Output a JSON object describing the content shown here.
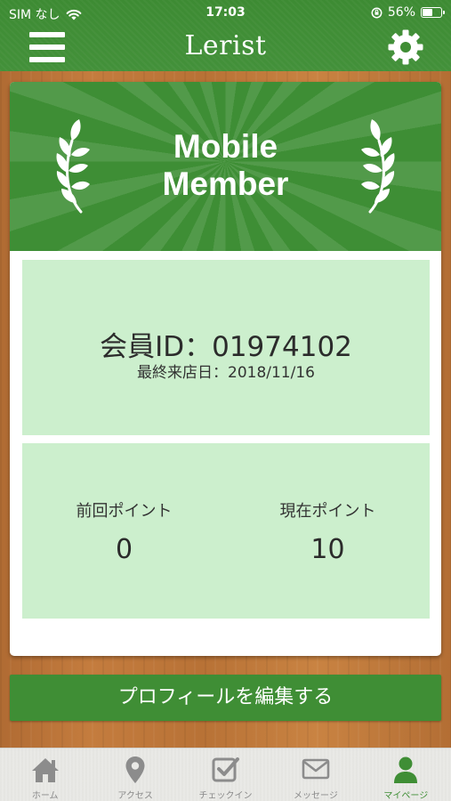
{
  "status": {
    "carrier": "SIM なし",
    "time": "17:03",
    "battery_text": "56%",
    "battery_level": 0.56
  },
  "header": {
    "title": "Lerist",
    "menu_icon": "hamburger-menu-icon",
    "settings_icon": "gear-icon"
  },
  "card": {
    "banner_title_line1": "Mobile",
    "banner_title_line2": "Member",
    "member_id": "会員ID：01974102",
    "last_visit": "最終来店日：2018/11/16",
    "previous_points_label": "前回ポイント",
    "previous_points_value": "0",
    "current_points_label": "現在ポイント",
    "current_points_value": "10"
  },
  "actions": {
    "edit_profile_label": "プロフィールを編集する"
  },
  "tabs": [
    {
      "label": "ホーム",
      "icon": "home-icon"
    },
    {
      "label": "アクセス",
      "icon": "map-pin-icon"
    },
    {
      "label": "チェックイン",
      "icon": "checkbox-icon"
    },
    {
      "label": "メッセージ",
      "icon": "envelope-icon"
    },
    {
      "label": "マイページ",
      "icon": "user-icon"
    }
  ],
  "colors": {
    "primary_green": "#3f8e35",
    "panel_green": "#ccefcd",
    "active_tab": "#3f8e35",
    "inactive_tab": "#8a8a8a"
  }
}
